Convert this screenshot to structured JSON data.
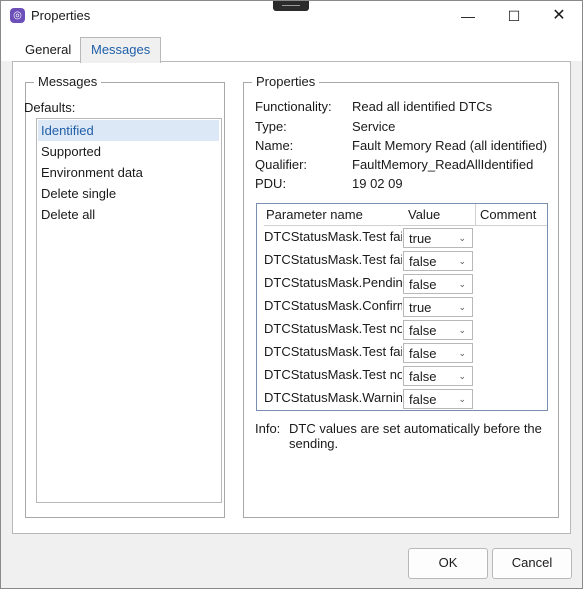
{
  "window": {
    "title": "Properties",
    "icon": "app-icon",
    "controls": {
      "minimize": "—",
      "maximize": "☐",
      "close": "✕"
    }
  },
  "tabs": [
    {
      "label": "General"
    },
    {
      "label": "Messages",
      "active": true
    }
  ],
  "messages_group": {
    "title": "Messages",
    "defaults_label": "Defaults:",
    "items": [
      "Identified",
      "Supported",
      "Environment data",
      "Delete single",
      "Delete all"
    ],
    "selected_index": 0
  },
  "properties_group": {
    "title": "Properties",
    "fields": [
      {
        "label": "Functionality:",
        "value": "Read all identified DTCs"
      },
      {
        "label": "Type:",
        "value": "Service"
      },
      {
        "label": "Name:",
        "value": "Fault Memory Read (all identified)"
      },
      {
        "label": "Qualifier:",
        "value": "FaultMemory_ReadAllIdentified"
      },
      {
        "label": "PDU:",
        "value": "19 02 09"
      }
    ],
    "grid": {
      "headers": {
        "name": "Parameter name",
        "value": "Value",
        "comment": "Comment"
      },
      "rows": [
        {
          "name": "DTCStatusMask.Test fail",
          "value": "true"
        },
        {
          "name": "DTCStatusMask.Test fail",
          "value": "false"
        },
        {
          "name": "DTCStatusMask.Pending",
          "value": "false"
        },
        {
          "name": "DTCStatusMask.Confirm",
          "value": "true"
        },
        {
          "name": "DTCStatusMask.Test not",
          "value": "false"
        },
        {
          "name": "DTCStatusMask.Test fail",
          "value": "false"
        },
        {
          "name": "DTCStatusMask.Test not",
          "value": "false"
        },
        {
          "name": "DTCStatusMask.Warning",
          "value": "false"
        }
      ]
    },
    "info": {
      "label": "Info:",
      "text": "DTC values are set automatically before the sending."
    }
  },
  "buttons": {
    "ok": "OK",
    "cancel": "Cancel"
  },
  "colors": {
    "accent": "#1f5fa8",
    "selection": "#dde8f6"
  }
}
